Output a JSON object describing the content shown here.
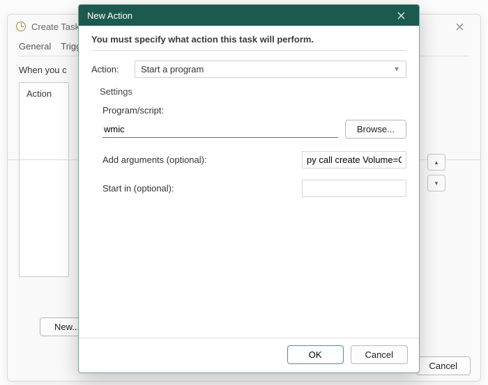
{
  "parent": {
    "title": "Create Task",
    "tabs": [
      "General",
      "Triggers"
    ],
    "when_label": "When you c",
    "action_header": "Action",
    "new_btn": "New...",
    "cancel_btn": "Cancel"
  },
  "dialog": {
    "title": "New Action",
    "must_specify": "You must specify what action this task will perform.",
    "action_label": "Action:",
    "action_value": "Start a program",
    "settings_header": "Settings",
    "program_label": "Program/script:",
    "program_value": "wmic",
    "browse_btn": "Browse...",
    "args_label": "Add arguments (optional):",
    "args_value": "py call create Volume=C:\\",
    "startin_label": "Start in (optional):",
    "startin_value": "",
    "ok_btn": "OK",
    "cancel_btn": "Cancel"
  }
}
